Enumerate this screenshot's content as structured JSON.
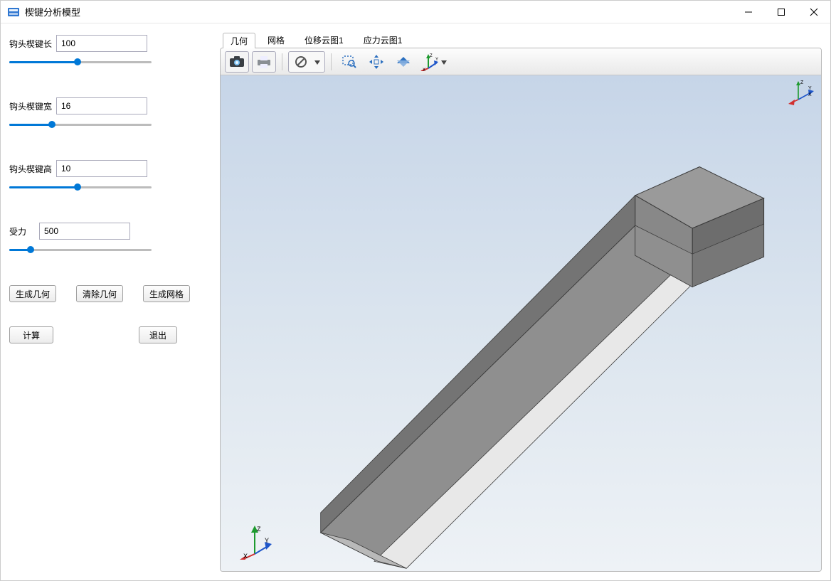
{
  "window": {
    "title": "楔键分析模型"
  },
  "params": {
    "length": {
      "label": "钩头楔键长",
      "value": "100",
      "percent": 48
    },
    "width": {
      "label": "钩头楔键宽",
      "value": "16",
      "percent": 30
    },
    "height": {
      "label": "钩头楔键高",
      "value": "10",
      "percent": 48
    },
    "force": {
      "label": "受力",
      "value": "500",
      "percent": 15
    }
  },
  "buttons": {
    "gen_geom": "生成几何",
    "clear_geom": "清除几何",
    "gen_mesh": "生成网格",
    "compute": "计算",
    "exit": "退出"
  },
  "tabs": {
    "active_index": 0,
    "items": [
      "几何",
      "网格",
      "位移云图1",
      "应力云图1"
    ]
  },
  "toolbar": {
    "icons": {
      "snapshot": "snapshot-icon",
      "print": "print-icon",
      "view_opts": "view-options-icon",
      "zoom_window": "zoom-window-icon",
      "pan": "pan-icon",
      "fit": "fit-icon",
      "axis": "axis-orient-icon"
    }
  },
  "axis_labels": {
    "x": "X",
    "y": "Y",
    "z": "Z"
  }
}
